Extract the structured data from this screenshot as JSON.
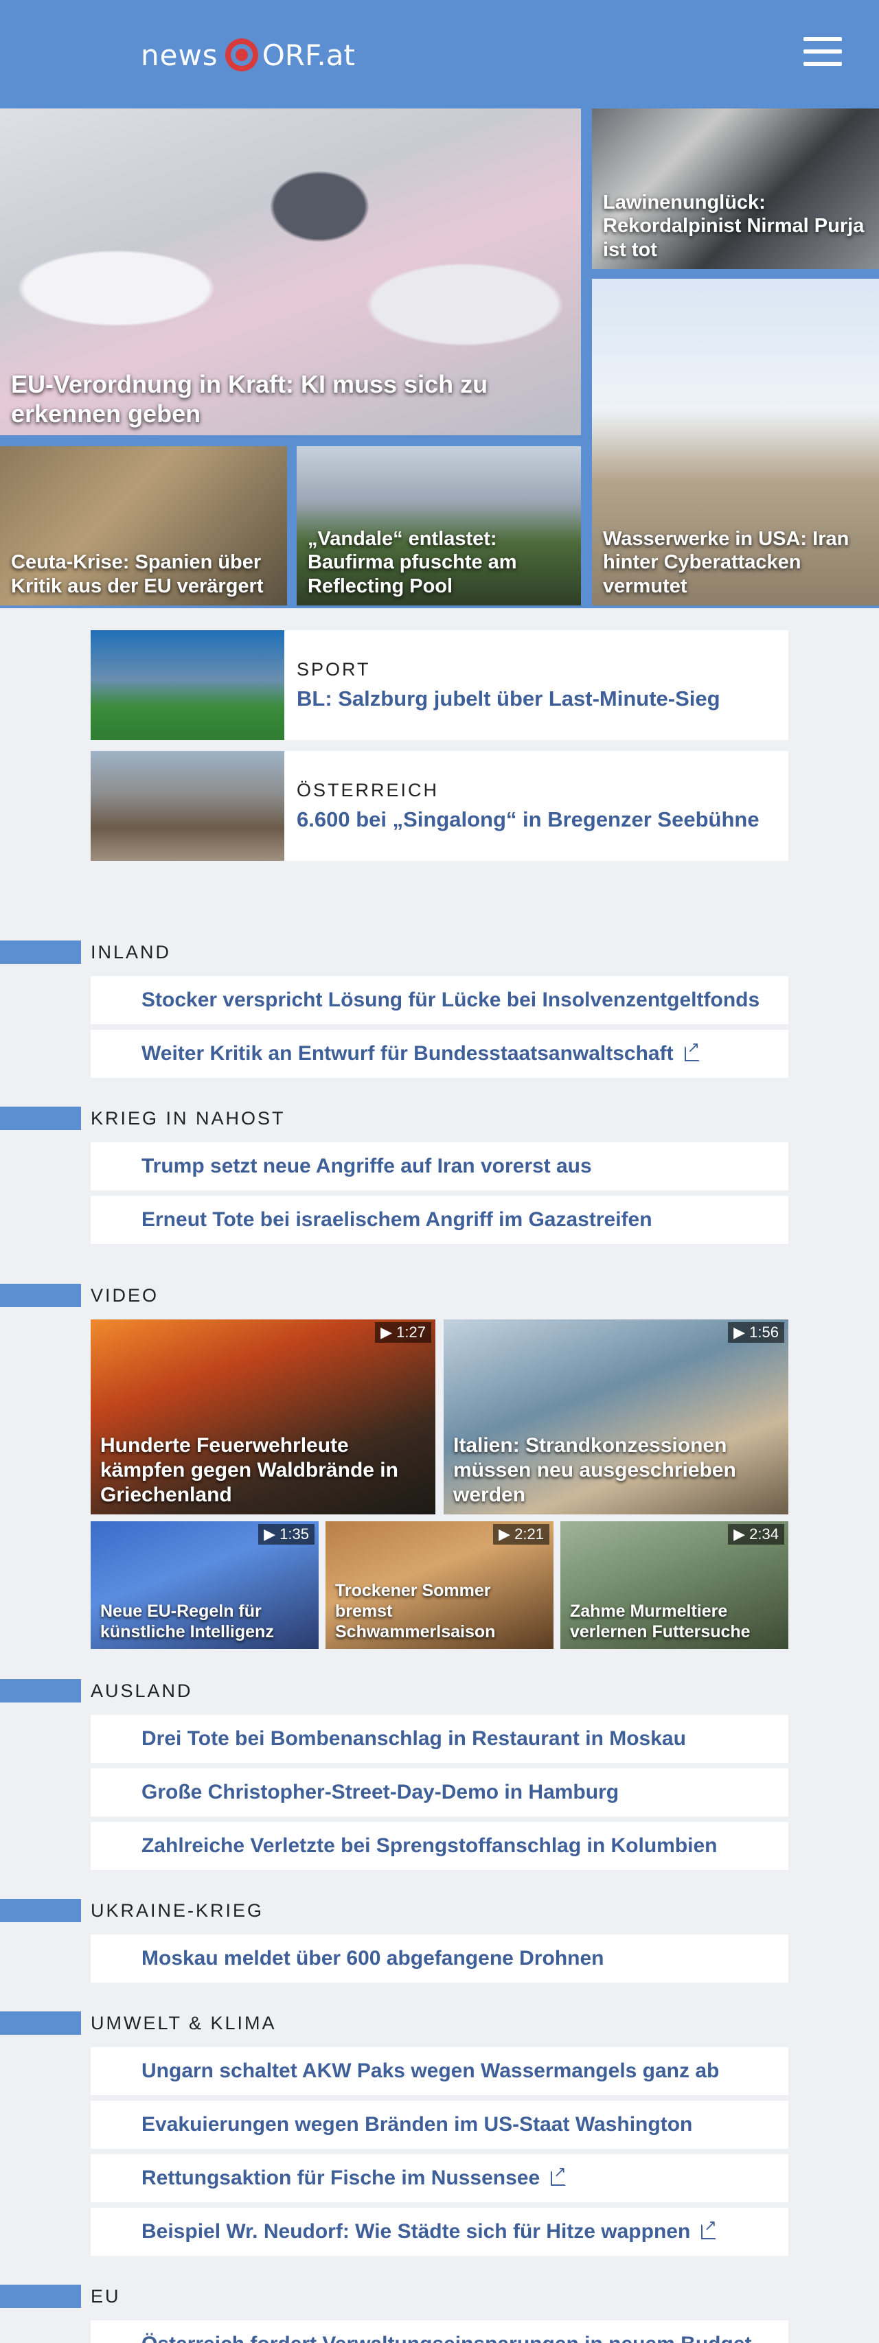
{
  "header": {
    "logo_news": "news",
    "logo_orf": "ORF.at",
    "menu_icon": "hamburger-icon",
    "brand_color": "#5b8fd2",
    "logo_accent": "#d93a3a"
  },
  "hero": {
    "main": "EU-Verordnung in Kraft: KI muss sich zu erkennen geben",
    "lawine": "Lawinenunglück: Rekordalpinist Nirmal Purja ist tot",
    "water": "Wasserwerke in USA: Iran hinter Cyberattacken vermutet",
    "ceuta": "Ceuta-Krise: Spanien über Kritik aus der EU verärgert",
    "vandal": "„Vandale“ entlastet: Baufirma pfuschte am Reflecting Pool"
  },
  "featured": [
    {
      "kicker": "SPORT",
      "title": "BL: Salzburg jubelt über Last-Minute-Sieg"
    },
    {
      "kicker": "ÖSTERREICH",
      "title": "6.600 bei „Singalong“ in Bregenzer Seebühne"
    }
  ],
  "sections": {
    "inland": {
      "label": "INLAND",
      "items": [
        "Stocker verspricht Lösung für Lücke bei Insolvenzentgeltfonds",
        "Weiter Kritik an Entwurf für Bundesstaatsanwaltschaft"
      ]
    },
    "nahost": {
      "label": "KRIEG IN NAHOST",
      "items": [
        "Trump setzt neue Angriffe auf Iran vorerst aus",
        "Erneut Tote bei israelischem Angriff im Gazastreifen"
      ]
    },
    "video": {
      "label": "VIDEO",
      "items": [
        {
          "title": "Hunderte Feuerwehrleute kämpfen gegen Waldbrände in Griechenland",
          "duration": "▶ 1:27"
        },
        {
          "title": "Italien: Strandkonzessionen müssen neu ausgeschrieben werden",
          "duration": "▶ 1:56"
        },
        {
          "title": "Neue EU-Regeln für künstliche Intelligenz",
          "duration": "▶ 1:35"
        },
        {
          "title": "Trockener Sommer bremst Schwammerlsaison",
          "duration": "▶ 2:21"
        },
        {
          "title": "Zahme Murmeltiere verlernen Futtersuche",
          "duration": "▶ 2:34"
        }
      ]
    },
    "ausland": {
      "label": "AUSLAND",
      "items": [
        "Drei Tote bei Bombenanschlag in Restaurant in Moskau",
        "Große Christopher-Street-Day-Demo in Hamburg",
        "Zahlreiche Verletzte bei Sprengstoffanschlag in Kolumbien"
      ]
    },
    "ukraine": {
      "label": "UKRAINE-KRIEG",
      "items": [
        "Moskau meldet über 600 abgefangene Drohnen"
      ]
    },
    "umwelt": {
      "label": "UMWELT & KLIMA",
      "items": [
        "Ungarn schaltet AKW Paks wegen Wassermangels ganz ab",
        "Evakuierungen wegen Bränden im US-Staat Washington",
        "Rettungsaktion für Fische im Nussensee",
        "Beispiel Wr. Neudorf: Wie Städte sich für Hitze wappnen"
      ]
    },
    "eu": {
      "label": "EU",
      "items": [
        "Österreich fordert Verwaltungseinsparungen in neuem Budget"
      ]
    }
  }
}
